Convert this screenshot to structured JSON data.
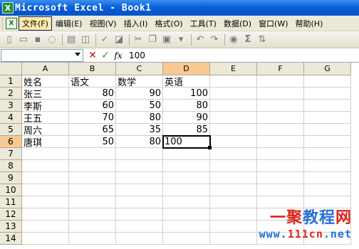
{
  "window": {
    "title": "Microsoft Excel - Book1",
    "app_icon": "X"
  },
  "menubar": {
    "items": [
      {
        "label": "文件(F)",
        "active": true
      },
      {
        "label": "编辑(E)"
      },
      {
        "label": "视图(V)"
      },
      {
        "label": "插入(I)"
      },
      {
        "label": "格式(O)"
      },
      {
        "label": "工具(T)"
      },
      {
        "label": "数据(D)"
      },
      {
        "label": "窗口(W)"
      },
      {
        "label": "帮助(H)"
      }
    ]
  },
  "toolbar": {
    "sigma_label": "Σ",
    "icons": [
      "new-icon",
      "open-icon",
      "save-icon",
      "permission-icon",
      "print-icon",
      "print-preview-icon",
      "spelling-icon",
      "research-icon",
      "cut-icon",
      "copy-icon",
      "paste-icon",
      "format-painter-icon",
      "undo-icon",
      "redo-icon",
      "hyperlink-icon",
      "autosum-icon",
      "sort-icon"
    ]
  },
  "formula_bar": {
    "name_box": "",
    "value": "100",
    "fx_label": "fx",
    "cancel_label": "✕",
    "enter_label": "✓"
  },
  "sheet": {
    "columns": [
      "A",
      "B",
      "C",
      "D",
      "E",
      "F",
      "G"
    ],
    "selected_column": "D",
    "selected_row": 6,
    "rows": [
      1,
      2,
      3,
      4,
      5,
      6,
      7,
      8,
      9,
      10,
      11,
      12,
      13,
      14
    ],
    "cells": {
      "r1": [
        "姓名",
        "语文",
        "数学",
        "英语"
      ],
      "r2": [
        "张三",
        "80",
        "90",
        "100"
      ],
      "r3": [
        "李斯",
        "60",
        "50",
        "80"
      ],
      "r4": [
        "王五",
        "70",
        "80",
        "90"
      ],
      "r5": [
        "周六",
        "65",
        "35",
        "85"
      ],
      "r6": [
        "唐琪",
        "50",
        "80",
        "100"
      ]
    }
  },
  "watermark": {
    "brand_part1": "一聚",
    "brand_part2": "教程",
    "brand_part3": "网",
    "url_part1": "www.",
    "url_part2": "111cn",
    "url_part3": ".net"
  },
  "colors": {
    "selected_header": "#f8c991",
    "titlebar": "#0a5fd8",
    "header_bg": "#ece9d8"
  }
}
